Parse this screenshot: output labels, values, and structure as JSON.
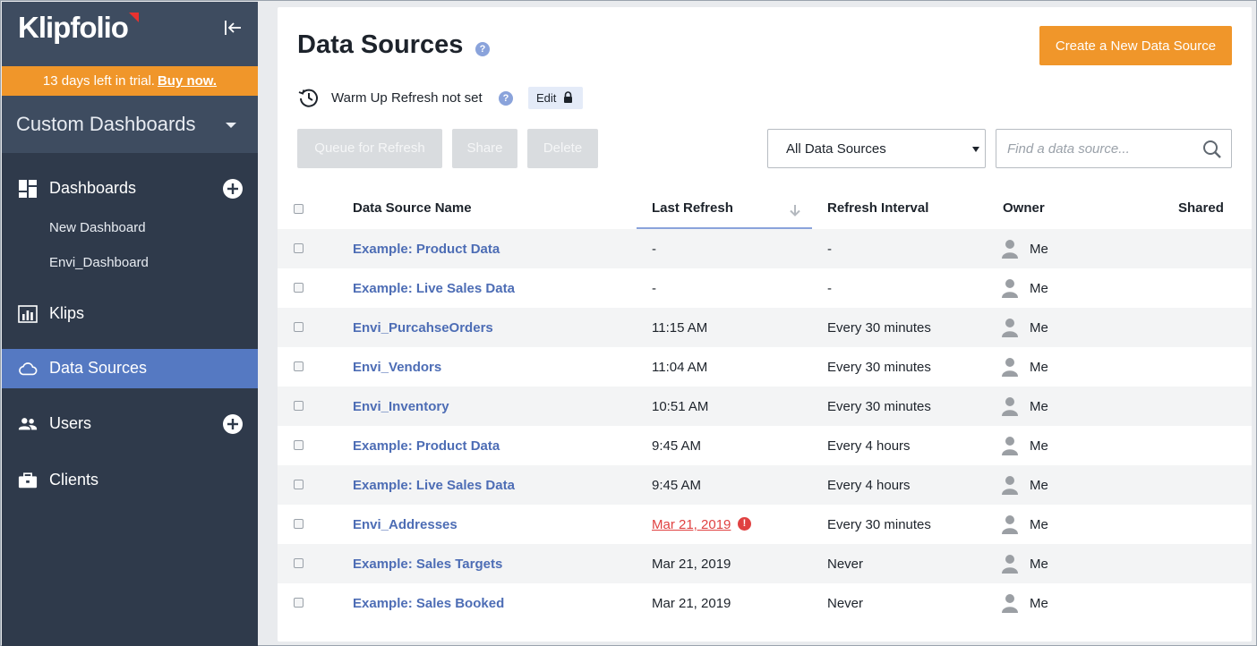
{
  "sidebar": {
    "logo": "Klipfolio",
    "trial_text": "13 days left in trial.",
    "trial_link": "Buy now.",
    "account_name": "Custom Dashboards",
    "nav": {
      "dashboards": "Dashboards",
      "klips": "Klips",
      "data_sources": "Data Sources",
      "users": "Users",
      "clients": "Clients"
    },
    "dashboards_sub": [
      "New Dashboard",
      "Envi_Dashboard"
    ],
    "active_item": "Data Sources"
  },
  "header": {
    "title": "Data Sources",
    "help_glyph": "?",
    "create_label": "Create a New Data Source",
    "warmup_text": "Warm Up Refresh not set",
    "edit_label": "Edit"
  },
  "toolbar": {
    "queue_label": "Queue for Refresh",
    "share_label": "Share",
    "delete_label": "Delete",
    "filter_value": "All Data Sources",
    "search_placeholder": "Find a data source..."
  },
  "table": {
    "columns": {
      "name": "Data Source Name",
      "last_refresh": "Last Refresh",
      "interval": "Refresh Interval",
      "owner": "Owner",
      "shared": "Shared"
    },
    "sorted_by": "Last Refresh",
    "rows": [
      {
        "name": "Example: Product Data",
        "last_refresh": "-",
        "interval": "-",
        "owner": "Me",
        "error": false
      },
      {
        "name": "Example: Live Sales Data",
        "last_refresh": "-",
        "interval": "-",
        "owner": "Me",
        "error": false
      },
      {
        "name": "Envi_PurcahseOrders",
        "last_refresh": "11:15 AM",
        "interval": "Every 30 minutes",
        "owner": "Me",
        "error": false
      },
      {
        "name": "Envi_Vendors",
        "last_refresh": "11:04 AM",
        "interval": "Every 30 minutes",
        "owner": "Me",
        "error": false
      },
      {
        "name": "Envi_Inventory",
        "last_refresh": "10:51 AM",
        "interval": "Every 30 minutes",
        "owner": "Me",
        "error": false
      },
      {
        "name": "Example: Product Data",
        "last_refresh": "9:45 AM",
        "interval": "Every 4 hours",
        "owner": "Me",
        "error": false
      },
      {
        "name": "Example: Live Sales Data",
        "last_refresh": "9:45 AM",
        "interval": "Every 4 hours",
        "owner": "Me",
        "error": false
      },
      {
        "name": "Envi_Addresses",
        "last_refresh": "Mar 21, 2019",
        "interval": "Every 30 minutes",
        "owner": "Me",
        "error": true,
        "error_glyph": "!"
      },
      {
        "name": "Example: Sales Targets",
        "last_refresh": "Mar 21, 2019",
        "interval": "Never",
        "owner": "Me",
        "error": false
      },
      {
        "name": "Example: Sales Booked",
        "last_refresh": "Mar 21, 2019",
        "interval": "Never",
        "owner": "Me",
        "error": false
      }
    ]
  },
  "colors": {
    "sidebar_bg": "#2f3a4b",
    "accent_orange": "#f0962a",
    "active_blue": "#5579c2",
    "link_blue": "#4d6db5",
    "error_red": "#e04141"
  }
}
